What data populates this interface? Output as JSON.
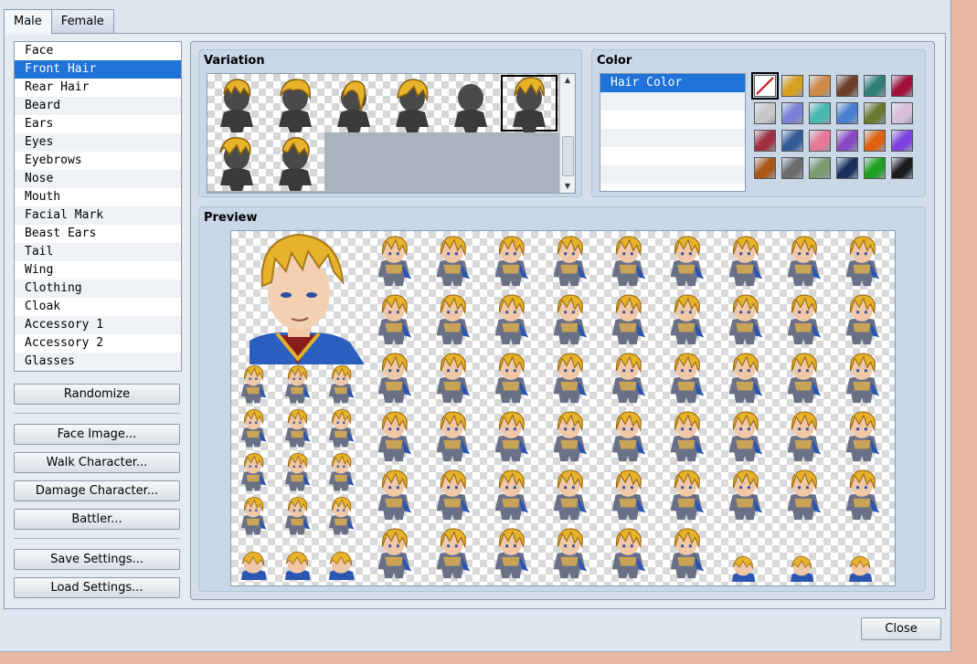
{
  "tabs": [
    "Male",
    "Female"
  ],
  "parts": [
    "Face",
    "Front Hair",
    "Rear Hair",
    "Beard",
    "Ears",
    "Eyes",
    "Eyebrows",
    "Nose",
    "Mouth",
    "Facial Mark",
    "Beast Ears",
    "Tail",
    "Wing",
    "Clothing",
    "Cloak",
    "Accessory 1",
    "Accessory 2",
    "Glasses"
  ],
  "selected_part": "Front Hair",
  "buttons": {
    "randomize": "Randomize",
    "face_image": "Face Image...",
    "walk_character": "Walk Character...",
    "damage_character": "Damage Character...",
    "battler": "Battler...",
    "save_settings": "Save Settings...",
    "load_settings": "Load Settings...",
    "close": "Close"
  },
  "variation": {
    "title": "Variation",
    "count": 8,
    "selected_index": 5
  },
  "color": {
    "title": "Color",
    "items": [
      "Hair Color"
    ],
    "swatches": [
      "none",
      "#d8a020",
      "#d08a48",
      "#6a4028",
      "#2f7f74",
      "#a01038",
      "#c8c8c8",
      "#7f7fd8",
      "#48b8b0",
      "#4a7fd0",
      "#6a7a30",
      "#d8c0d8",
      "#a03040",
      "#345a98",
      "#e87898",
      "#8848c0",
      "#e06010",
      "#8040e0",
      "#a85818",
      "#6c6c6c",
      "#7a9a70",
      "#1a2f60",
      "#20a020",
      "#1c1c1c"
    ],
    "selected_swatch": 0
  },
  "preview": {
    "title": "Preview"
  }
}
